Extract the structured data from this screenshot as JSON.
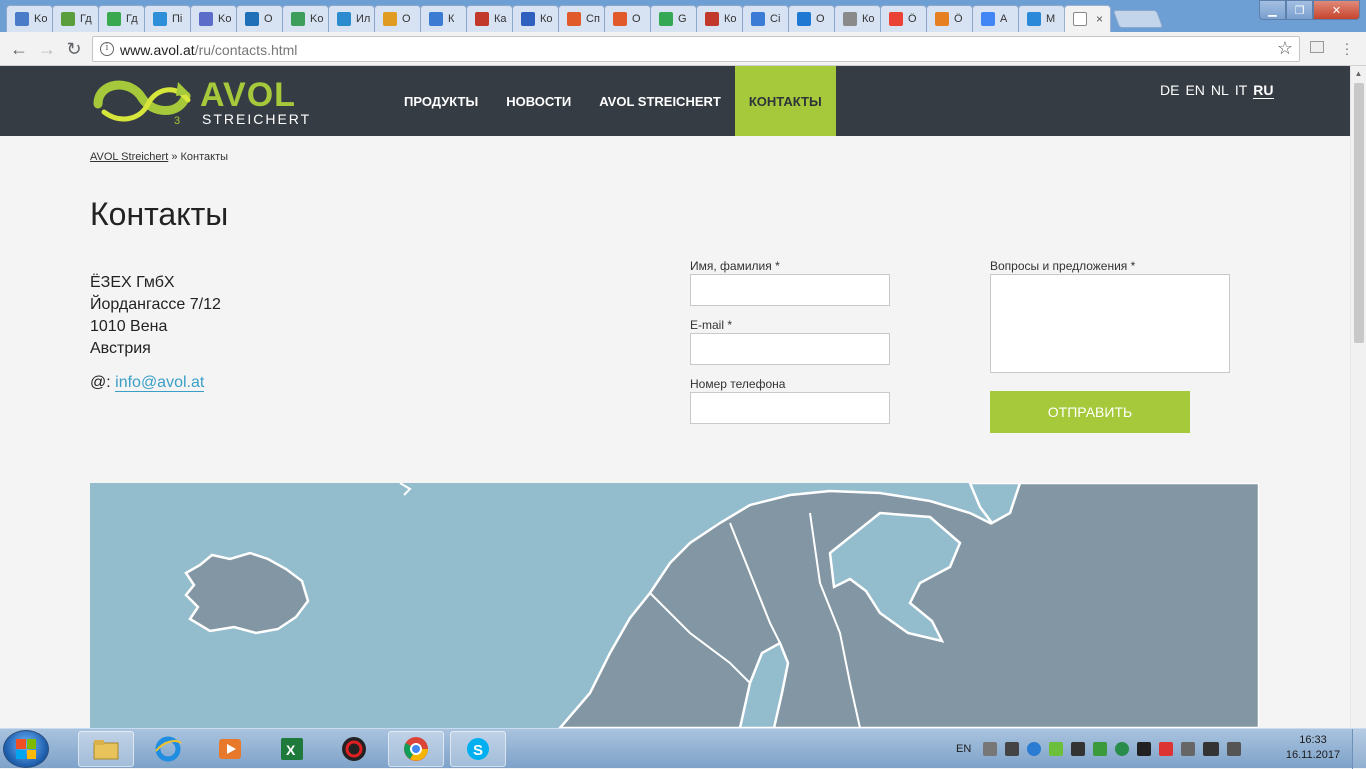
{
  "browser": {
    "tabs": [
      {
        "title": "Ko",
        "color": "#4a7bc8"
      },
      {
        "title": "Гд",
        "color": "#5a9e3d"
      },
      {
        "title": "Гд",
        "color": "#3aa84f"
      },
      {
        "title": "Пі",
        "color": "#2c8fd8"
      },
      {
        "title": "Ko",
        "color": "#5b6cc9"
      },
      {
        "title": "O",
        "color": "#1e6fb8"
      },
      {
        "title": "Ko",
        "color": "#3d9e5b"
      },
      {
        "title": "Ил",
        "color": "#2b8ccf"
      },
      {
        "title": "О",
        "color": "#e09b23"
      },
      {
        "title": "К",
        "color": "#3b7bd2"
      },
      {
        "title": "Ка",
        "color": "#c0392b"
      },
      {
        "title": "Ко",
        "color": "#2f5fbf"
      },
      {
        "title": "Сп",
        "color": "#e05a2a"
      },
      {
        "title": "О",
        "color": "#e05a2a"
      },
      {
        "title": "G",
        "color": "#34a853"
      },
      {
        "title": "Ко",
        "color": "#c0392b"
      },
      {
        "title": "Сі",
        "color": "#3a7bd5"
      },
      {
        "title": "О",
        "color": "#1f78d1"
      },
      {
        "title": "Ко",
        "color": "#8a8a8a"
      },
      {
        "title": "Ö",
        "color": "#ea4335"
      },
      {
        "title": "Ö",
        "color": "#e67e22"
      },
      {
        "title": "А",
        "color": "#4285f4"
      },
      {
        "title": "М",
        "color": "#2a89d8"
      }
    ],
    "active_tab_close": "×",
    "url_host": "www.avol.at",
    "url_path": "/ru/contacts.html"
  },
  "site": {
    "logo_text": "AVOL",
    "logo_sub": "STREICHERT",
    "logo_mark": "3",
    "nav": [
      {
        "label": "ПРОДУКТЫ"
      },
      {
        "label": "НОВОСТИ"
      },
      {
        "label": "AVOL STREICHERT"
      },
      {
        "label": "КОНТАКТЫ"
      }
    ],
    "languages": [
      "DE",
      "EN",
      "NL",
      "IT",
      "RU"
    ],
    "selected_language": "RU"
  },
  "breadcrumb": {
    "home": "AVOL Streichert",
    "separator": "»",
    "current": "Контакты"
  },
  "page_title": "Контакты",
  "address": {
    "company": "ЁЗЕХ ГмбХ",
    "street": "Йордангассе 7/12",
    "city": "1010 Вена",
    "country": "Австрия",
    "email_prefix": "@:",
    "email": "info@avol.at"
  },
  "form": {
    "name_label": "Имя, фамилия *",
    "name_value": "",
    "email_label": "E-mail *",
    "email_value": "",
    "phone_label": "Номер телефона",
    "phone_value": "",
    "message_label": "Вопросы и предложения *",
    "message_value": "",
    "submit_label": "ОТПРАВИТЬ"
  },
  "colors": {
    "header_bg": "#353c43",
    "accent_green": "#a6c93b",
    "link_blue": "#3a9fc7",
    "sea": "#93bccc",
    "land": "#8296a3"
  },
  "taskbar": {
    "apps": [
      "explorer",
      "internet-explorer",
      "media-player",
      "excel",
      "security-app",
      "chrome",
      "skype"
    ],
    "input_language": "EN",
    "time": "16:33",
    "date": "16.11.2017"
  }
}
